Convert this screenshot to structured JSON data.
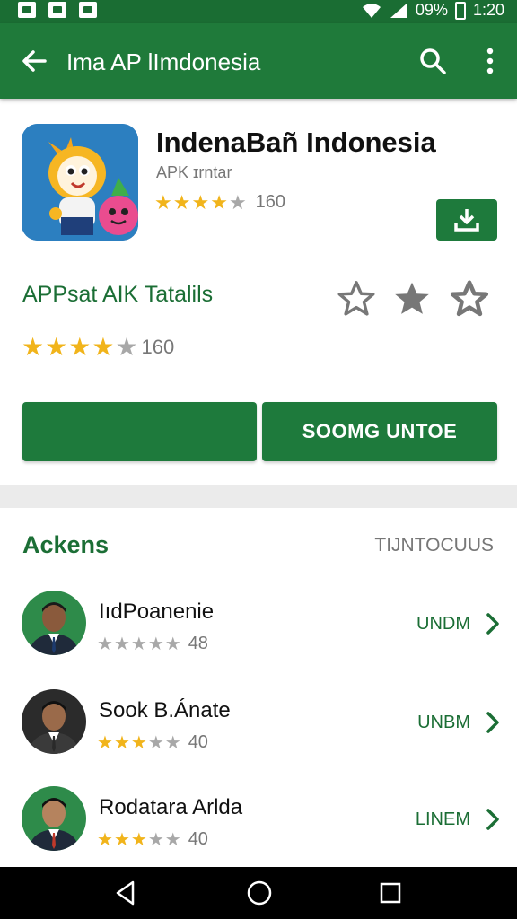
{
  "status_bar": {
    "battery": "09%",
    "time": "1:20"
  },
  "app_bar": {
    "title": "Ima AP lImdonesia"
  },
  "app": {
    "name": "IndenaBañ Indonesia",
    "subtitle": "APK ɪrntar",
    "rating_count": "160",
    "stars_on": 4
  },
  "details": {
    "title": "APPsat AIK Tatalils",
    "rating_count": "160",
    "stars_on": 4
  },
  "buttons": {
    "left_label": "",
    "right_label": "SOOMG UNTOE"
  },
  "list": {
    "title": "Ackens",
    "link": "TIJNTOCUUS",
    "items": [
      {
        "name": "IıdPoanenie",
        "rating_count": "48",
        "stars_on": 0,
        "action": "UNDM"
      },
      {
        "name": "Sook B.Ánate",
        "rating_count": "40",
        "stars_on": 3,
        "action": "UNBM"
      },
      {
        "name": "Rodatara Arlda",
        "rating_count": "40",
        "stars_on": 3,
        "action": "LINEM"
      }
    ]
  },
  "colors": {
    "primary": "#1f7a3a",
    "primary_dark": "#1a6d33",
    "star": "#f1b41b"
  }
}
